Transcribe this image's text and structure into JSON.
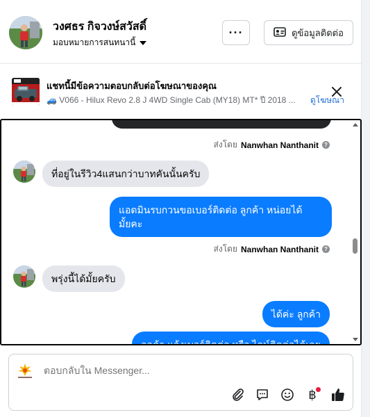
{
  "header": {
    "contact_name": "วงศธร กิจวงษ์สวัสดิ์",
    "assign_label": "มอบหมายการสนทนานี้",
    "more_label": "···",
    "info_button_label": "ดูข้อมูลติดต่อ"
  },
  "ad_banner": {
    "title": "แชทนี้มีข้อความตอบกลับต่อโฆษณาของคุณ",
    "subtitle": "🚙 V066 - Hilux Revo 2.8 J 4WD Single Cab (MY18) MT* ปี 2018 ...",
    "view_ad_link": "ดูโฆษณา",
    "thumb_brand": "Toyota"
  },
  "messages": [
    {
      "type": "sent_by",
      "prefix": "ส่งโดย",
      "name": "Nanwhan Nanthanit"
    },
    {
      "type": "incoming",
      "text": "ที่อยู่ในรีวิว4แสนกว่าบาทคันนั้นครับ"
    },
    {
      "type": "outgoing",
      "lines": [
        "แอดมินรบกวนขอเบอร์ติดต่อ ลูกค้า   หน่อยได้",
        "มั้ยคะ"
      ]
    },
    {
      "type": "sent_by",
      "prefix": "ส่งโดย",
      "name": "Nanwhan Nanthanit"
    },
    {
      "type": "incoming",
      "text": "พรุ่งนี้ได้มั้ยครับ"
    },
    {
      "type": "outgoing",
      "text": "ได้ค่ะ  ลูกค้า"
    },
    {
      "type": "outgoing",
      "text": "ลูกค้า แจ้งเบอร์ติดต่อ  หรือ ไลน์ติดต่อได้เลย"
    }
  ],
  "composer": {
    "placeholder": "ตอบกลับใน Messenger..."
  },
  "colors": {
    "outgoing_bubble": "#0a7cff",
    "incoming_bubble": "#e4e6eb",
    "link": "#216fdb",
    "badge_dot": "#e41e3f"
  },
  "icons": [
    "attachment-icon",
    "saved-reply-icon",
    "emoji-icon",
    "baht-payment-icon",
    "like-icon",
    "close-icon",
    "contact-card-icon"
  ]
}
